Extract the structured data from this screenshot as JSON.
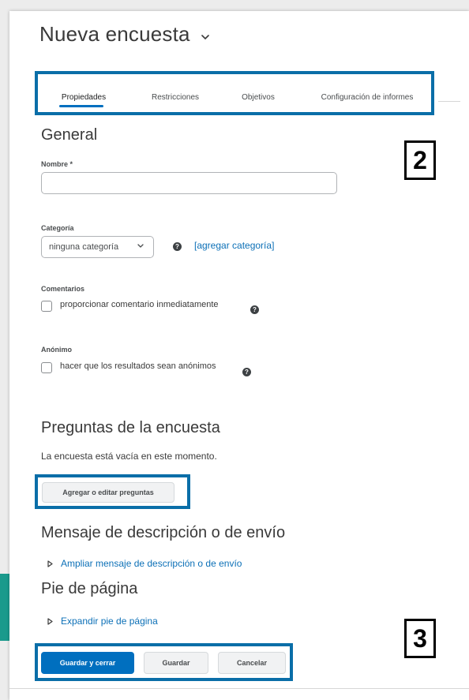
{
  "page": {
    "title": "Nueva encuesta",
    "title_menu_icon": "chevron-down-icon"
  },
  "tabs": [
    {
      "label": "Propiedades",
      "active": true
    },
    {
      "label": "Restricciones",
      "active": false
    },
    {
      "label": "Objetivos",
      "active": false
    },
    {
      "label": "Configuración de informes",
      "active": false
    }
  ],
  "annotations": {
    "badge_2": "2",
    "badge_3": "3"
  },
  "general": {
    "heading": "General",
    "name_label": "Nombre *",
    "name_value": "",
    "category_label": "Categoría",
    "category_selected": "ninguna categoría",
    "add_category_link": "[agregar categoría]",
    "comments_label": "Comentarios",
    "comments_checkbox": "proporcionar comentario inmediatamente",
    "comments_checked": false,
    "anonymous_label": "Anónimo",
    "anonymous_checkbox": "hacer que los resultados sean anónimos",
    "anonymous_checked": false,
    "help_icon": "question-circle-icon"
  },
  "questions": {
    "heading": "Preguntas de la encuesta",
    "empty_text": "La encuesta está vacía en este momento.",
    "add_button": "Agregar o editar preguntas"
  },
  "description": {
    "heading": "Mensaje de descripción o de envío",
    "expand_link": "Ampliar mensaje de descripción o de envío"
  },
  "footer_section": {
    "heading": "Pie de página",
    "expand_link": "Expandir pie de página"
  },
  "actions": {
    "save_close": "Guardar y cerrar",
    "save": "Guardar",
    "cancel": "Cancelar"
  },
  "colors": {
    "primary": "#006fbf",
    "link": "#0c70b7",
    "highlight_border": "#0a6ea8"
  }
}
